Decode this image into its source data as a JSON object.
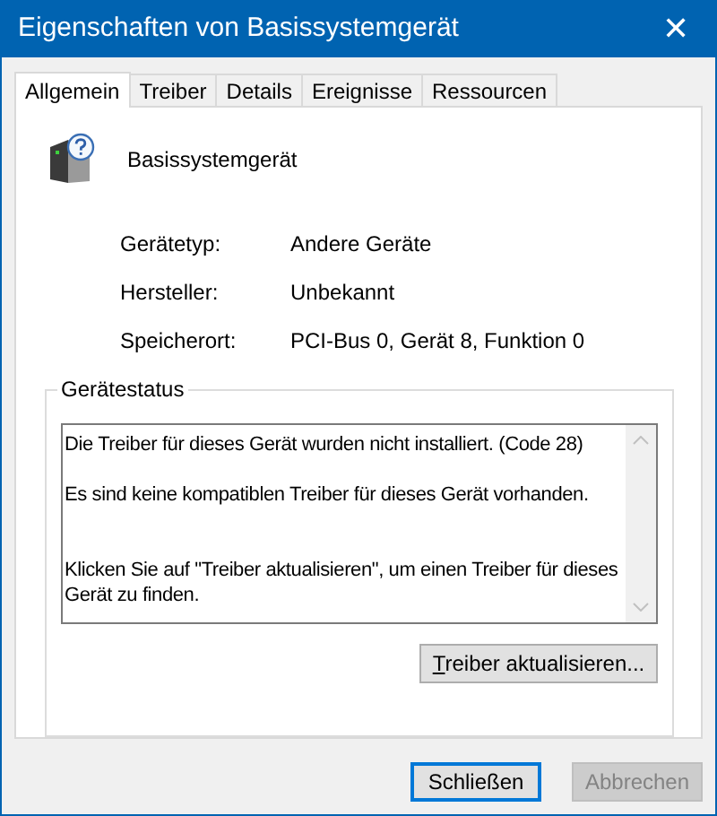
{
  "window": {
    "title": "Eigenschaften von Basissystemgerät",
    "close": "✕"
  },
  "tabs": [
    {
      "label": "Allgemein",
      "selected": true
    },
    {
      "label": "Treiber",
      "selected": false
    },
    {
      "label": "Details",
      "selected": false
    },
    {
      "label": "Ereignisse",
      "selected": false
    },
    {
      "label": "Ressourcen",
      "selected": false
    }
  ],
  "device": {
    "name": "Basissystemgerät"
  },
  "properties": [
    {
      "label": "Gerätetyp:",
      "value": "Andere Geräte"
    },
    {
      "label": "Hersteller:",
      "value": "Unbekannt"
    },
    {
      "label": "Speicherort:",
      "value": "PCI-Bus 0, Gerät 8, Funktion 0"
    }
  ],
  "status_group": {
    "title": "Gerätestatus",
    "text": "Die Treiber für dieses Gerät wurden nicht installiert. (Code 28)\n\nEs sind keine kompatiblen Treiber für dieses Gerät vorhanden.\n\n\nKlicken Sie auf \"Treiber aktualisieren\", um einen Treiber für dieses Gerät zu finden.",
    "button": "Treiber aktualisieren..."
  },
  "buttons": [
    {
      "label": "Schließen",
      "disabled": false,
      "default": true
    },
    {
      "label": "Abbrechen",
      "disabled": true,
      "default": false
    }
  ]
}
